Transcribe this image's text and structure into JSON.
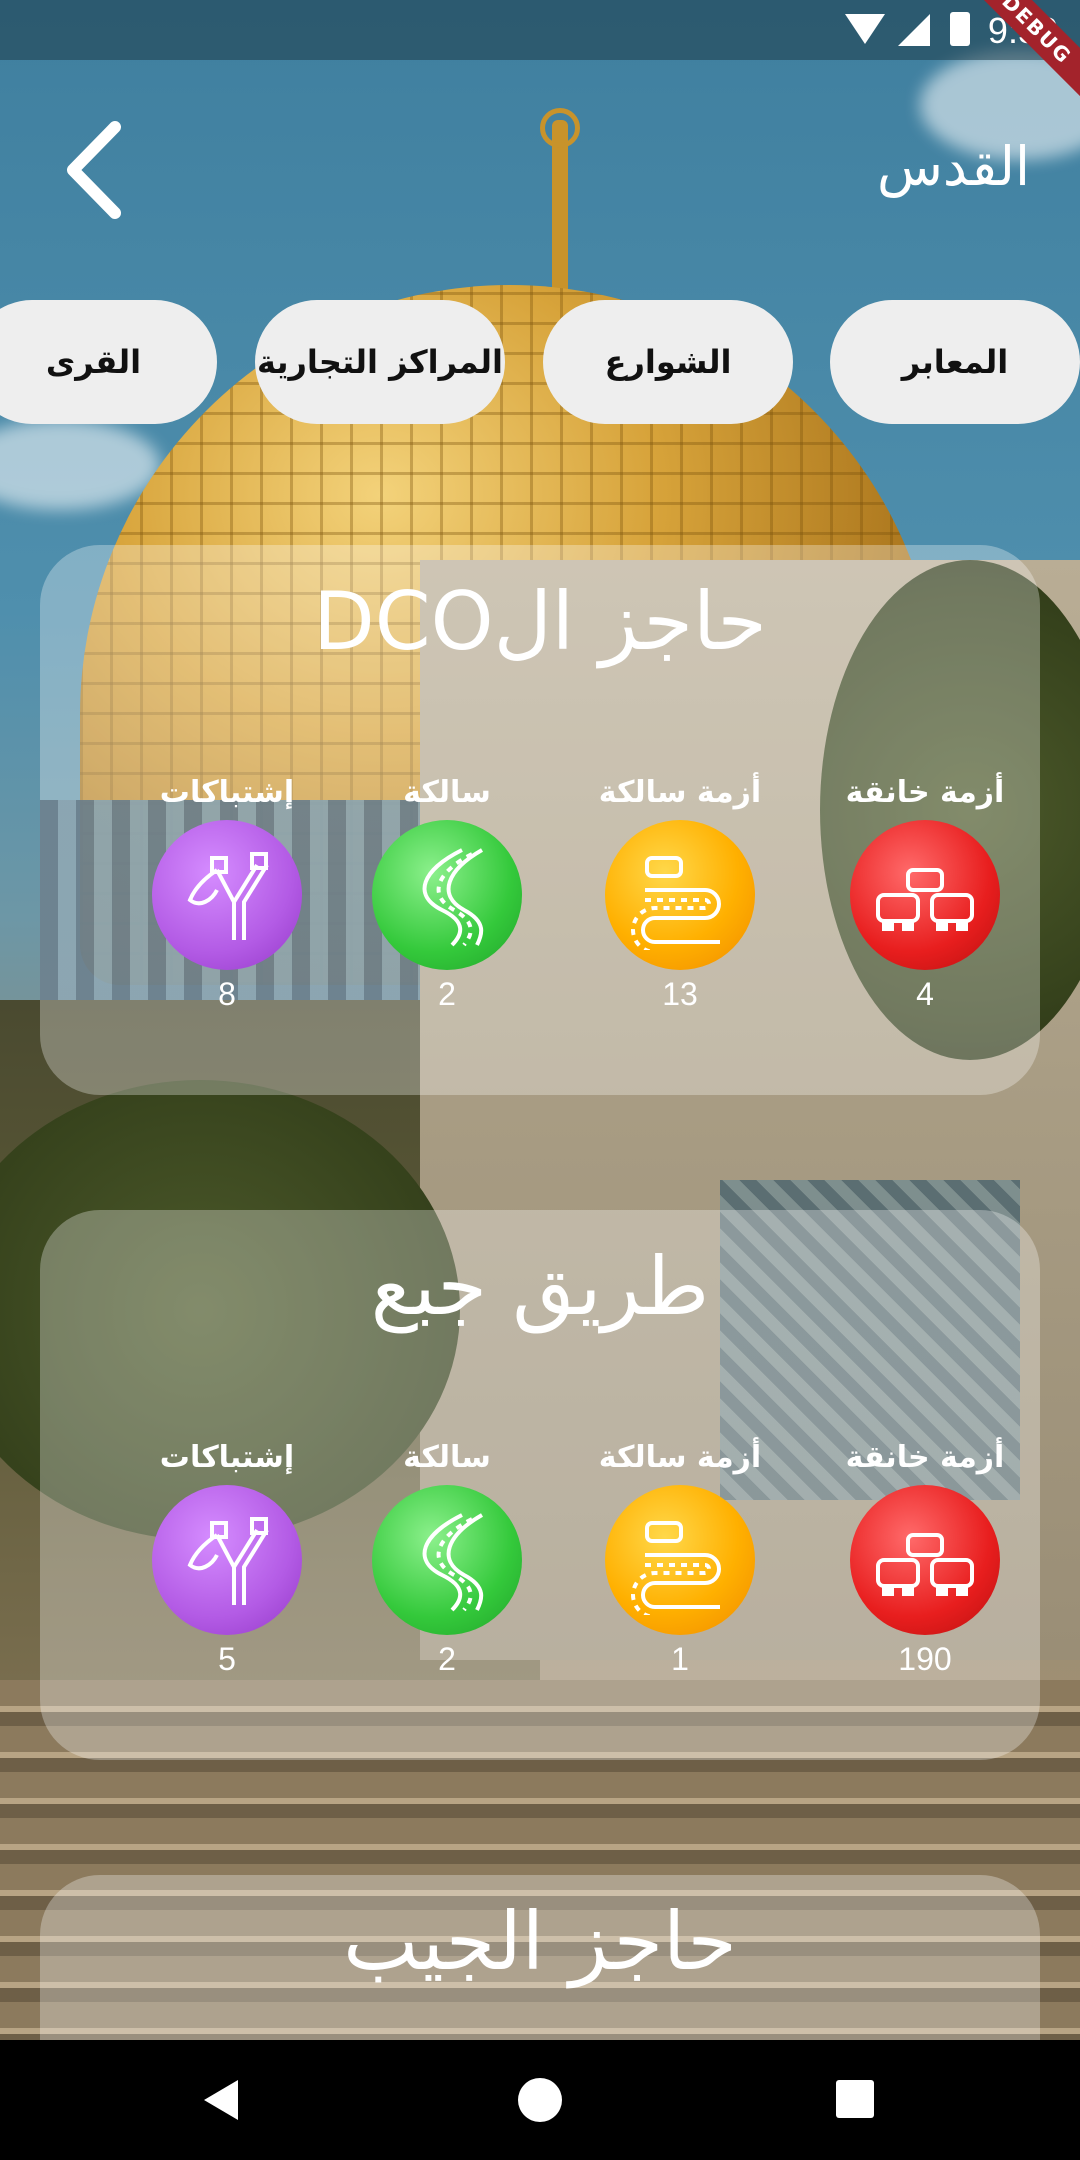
{
  "status_bar": {
    "time": "9:50",
    "debug_label": "DEBUG"
  },
  "header": {
    "title": "القدس"
  },
  "categories": [
    {
      "label": "المعابر"
    },
    {
      "label": "الشوارع"
    },
    {
      "label": "المراكز التجارية"
    },
    {
      "label": "القرى"
    }
  ],
  "stat_labels": {
    "heavy": "أزمة خانقة",
    "moderate": "أزمة سالكة",
    "clear": "سالكة",
    "clashes": "إشتباكات"
  },
  "cards": [
    {
      "title": "حاجز الDCO",
      "counts": {
        "heavy": "4",
        "moderate": "13",
        "clear": "2",
        "clashes": "8"
      }
    },
    {
      "title": "طريق جبع",
      "counts": {
        "heavy": "190",
        "moderate": "1",
        "clear": "2",
        "clashes": "5"
      }
    },
    {
      "title": "حاجز الجيب"
    }
  ],
  "icons": {
    "heavy": "cars-jam-icon",
    "moderate": "winding-road-car-icon",
    "clear": "road-icon",
    "clashes": "slingshot-icon"
  },
  "colors": {
    "heavy": "#e81e1e",
    "moderate": "#ffb000",
    "clear": "#34c93b",
    "clashes": "#b35be5",
    "pill_bg": "#eeeeee"
  }
}
